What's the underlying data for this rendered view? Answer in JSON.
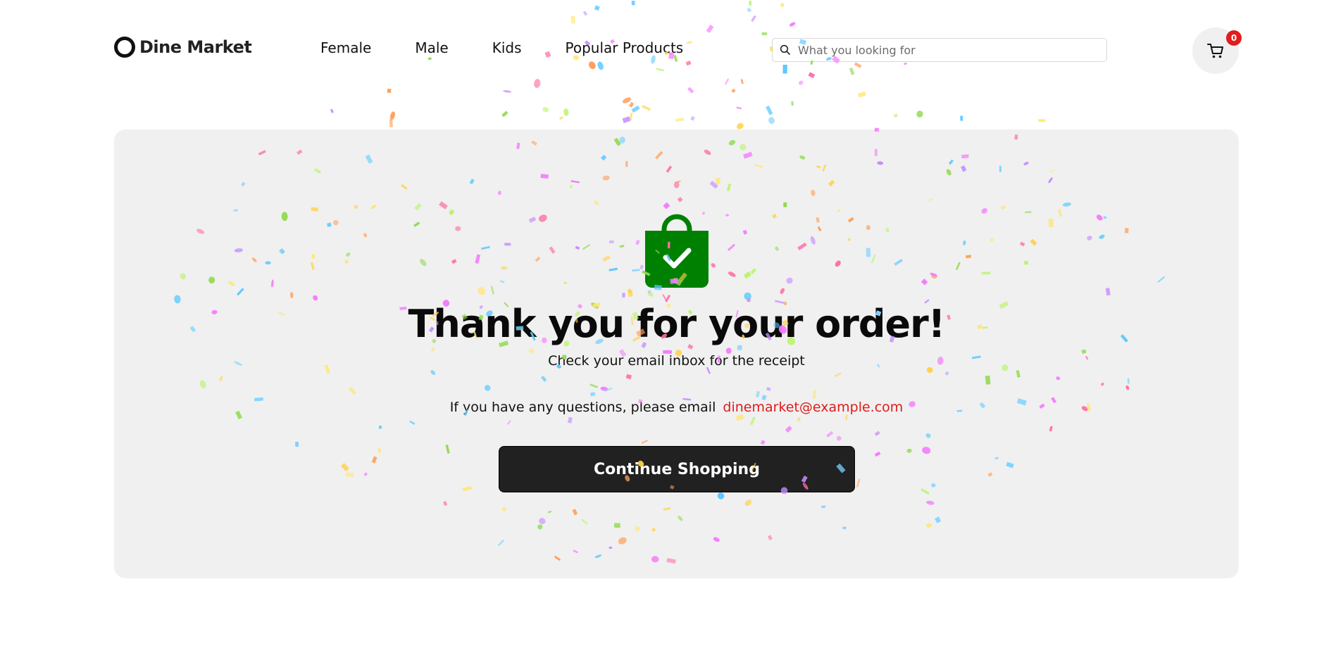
{
  "brand": {
    "name": "Dine Market"
  },
  "nav": {
    "items": [
      "Female",
      "Male",
      "Kids",
      "Popular Products"
    ]
  },
  "search": {
    "placeholder": "What you looking for",
    "value": ""
  },
  "cart": {
    "count": "0"
  },
  "order": {
    "title": "Thank you for your order!",
    "subtitle": "Check your email inbox for the receipt",
    "questions_text": "If you have any questions, please email",
    "email": "dinemarket@example.com",
    "button_label": "Continue Shopping"
  },
  "colors": {
    "accent_red": "#e01b1b",
    "bag_green": "#008000",
    "button_dark": "#212121",
    "card_bg": "#f0f0f0"
  },
  "icons": [
    "logo-ring-icon",
    "search-icon",
    "cart-icon",
    "shopping-bag-check-icon"
  ]
}
